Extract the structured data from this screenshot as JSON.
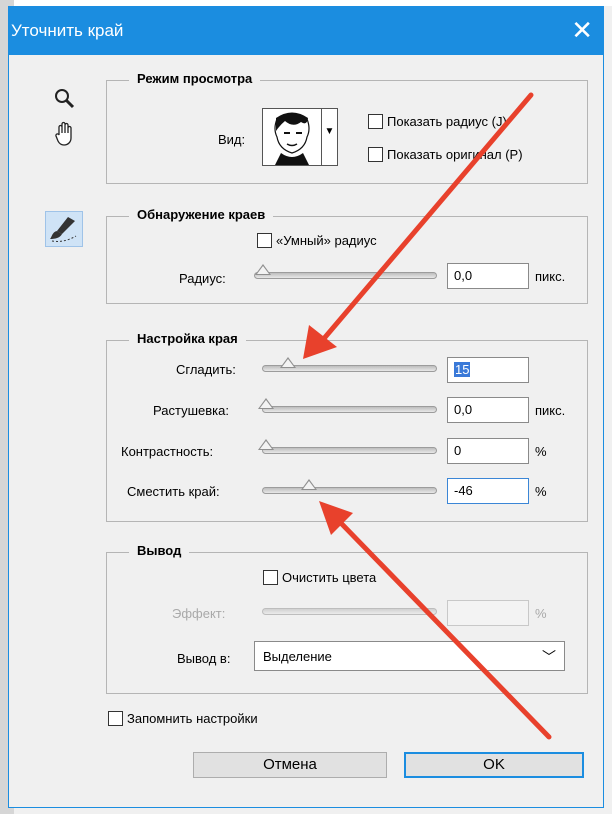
{
  "dialog": {
    "title": "Уточнить край"
  },
  "view_mode": {
    "legend": "Режим просмотра",
    "view_label": "Вид:",
    "show_radius": "Показать радиус (J)",
    "show_original": "Показать оригинал (P)"
  },
  "edge_detection": {
    "legend": "Обнаружение краев",
    "smart_radius": "«Умный» радиус",
    "radius_label": "Радиус:",
    "radius_value": "0,0",
    "radius_unit": "пикс."
  },
  "edge_adjust": {
    "legend": "Настройка края",
    "smooth_label": "Сгладить:",
    "smooth_value": "15",
    "feather_label": "Растушевка:",
    "feather_value": "0,0",
    "feather_unit": "пикс.",
    "contrast_label": "Контрастность:",
    "contrast_value": "0",
    "contrast_unit": "%",
    "shift_label": "Сместить край:",
    "shift_value": "-46",
    "shift_unit": "%"
  },
  "output": {
    "legend": "Вывод",
    "decontaminate": "Очистить цвета",
    "amount_label": "Эффект:",
    "amount_value": "",
    "amount_unit": "%",
    "output_to_label": "Вывод в:",
    "output_to_value": "Выделение"
  },
  "remember_settings": "Запомнить настройки",
  "buttons": {
    "cancel": "Отмена",
    "ok": "OK"
  },
  "colors": {
    "accent": "#1b8de0",
    "annotation_arrow": "#e8412c"
  },
  "icons": [
    "zoom-icon",
    "hand-icon",
    "refine-radius-brush-icon",
    "close-icon",
    "chevron-down-icon"
  ]
}
